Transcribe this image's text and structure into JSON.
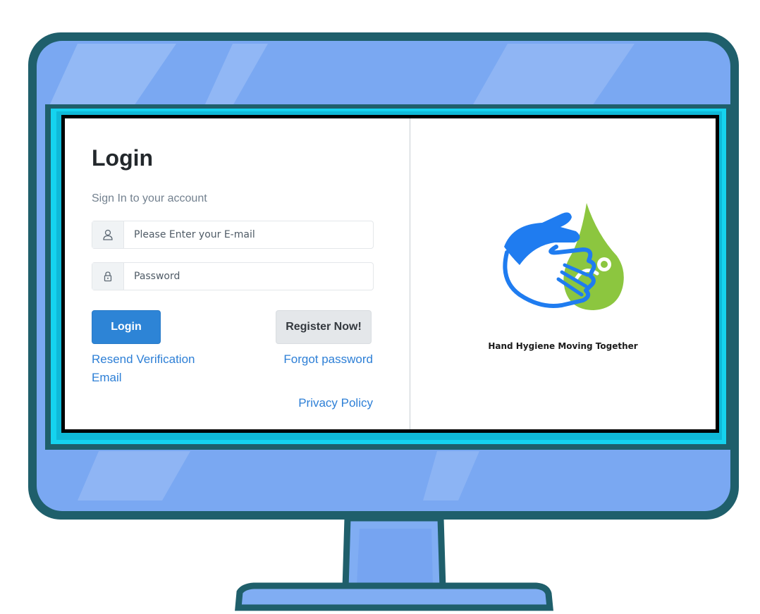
{
  "login": {
    "title": "Login",
    "subtitle": "Sign In to your account",
    "email": {
      "placeholder": "Please Enter your E-mail",
      "value": "",
      "icon": "user-icon"
    },
    "password": {
      "placeholder": "Password",
      "value": "",
      "icon": "lock-icon"
    },
    "login_button": "Login",
    "register_button": "Register Now!",
    "resend_link": "Resend Verification Email",
    "forgot_link": "Forgot password",
    "privacy_link": "Privacy Policy"
  },
  "brand": {
    "tagline": "Hand Hygiene Moving Together",
    "logo": "hand-hygiene-logo"
  },
  "colors": {
    "primary": "#2d84d6",
    "link": "#2d7fd6",
    "monitor_frame": "#1f5f6b",
    "monitor_body": "#7aa8f2",
    "screen_glow": "#15d3ef",
    "logo_blue": "#1f7cf0",
    "logo_green": "#8cc63f"
  }
}
